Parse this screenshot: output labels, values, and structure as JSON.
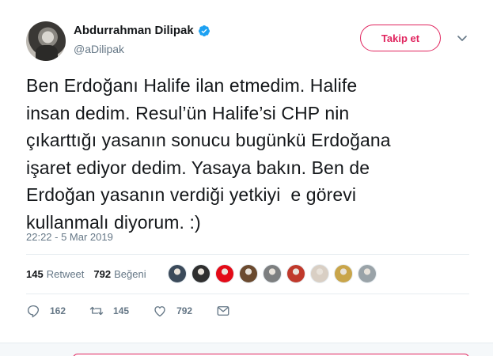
{
  "author": {
    "display_name": "Abdurrahman Dilipak",
    "handle": "@aDilipak",
    "verified": true
  },
  "follow_button": {
    "label": "Takip et"
  },
  "tweet": {
    "text": "Ben Erdoğanı Halife ilan etmedim. Halife\ninsan dedim. Resul’ün Halife’si CHP nin\nçıkarttığı yasanın sonucu bugünkü Erdoğana\nişaret ediyor dedim. Yasaya bakın. Ben de\nErdoğan yasanın verdiği yetkiyi  e görevi\nkullanmalı diyorum. :)",
    "timestamp": "22:22 - 5 Mar 2019"
  },
  "stats": {
    "retweets": {
      "count": "145",
      "label": "Retweet"
    },
    "likes": {
      "count": "792",
      "label": "Beğeni"
    }
  },
  "likers": [
    {
      "icon": "avatar-thumb",
      "color": "#3b4a5a"
    },
    {
      "icon": "avatar-thumb",
      "color": "#2f2f2f"
    },
    {
      "icon": "avatar-thumb",
      "color": "#e30a17"
    },
    {
      "icon": "avatar-thumb",
      "color": "#6b4a2f"
    },
    {
      "icon": "avatar-thumb",
      "color": "#7d7f80"
    },
    {
      "icon": "avatar-thumb",
      "color": "#c0392b"
    },
    {
      "icon": "avatar-thumb",
      "color": "#d9cfc4"
    },
    {
      "icon": "avatar-thumb",
      "color": "#c9a54a"
    },
    {
      "icon": "avatar-thumb",
      "color": "#9aa3a8"
    }
  ],
  "actions": {
    "reply": {
      "icon": "reply-icon",
      "count": "162"
    },
    "retweet": {
      "icon": "retweet-icon",
      "count": "145"
    },
    "like": {
      "icon": "heart-icon",
      "count": "792"
    },
    "share": {
      "icon": "envelope-icon"
    }
  },
  "colors": {
    "accent": "#1da1f2",
    "follow": "#e0245e",
    "muted": "#657786"
  }
}
